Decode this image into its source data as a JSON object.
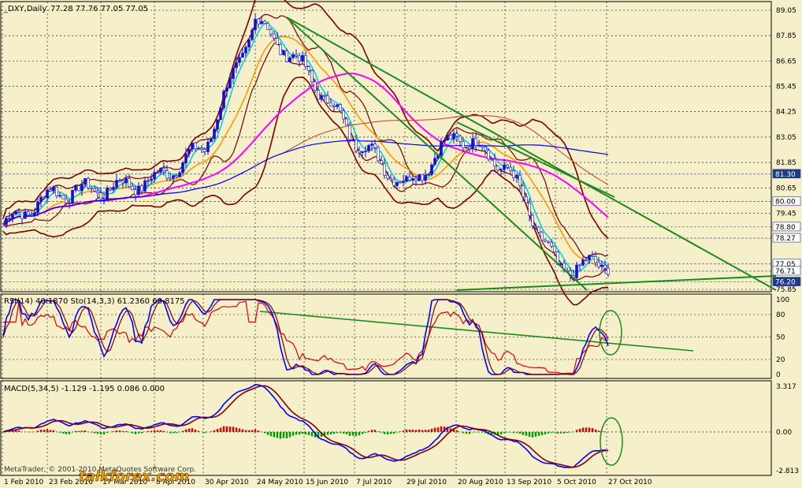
{
  "header": {
    "symbol": "_DXY,Daily",
    "ohlc": "77.28 77.76 77.05 77.05"
  },
  "colors": {
    "background": "#f5f0c9",
    "grid": "#000000",
    "bull_candle": "#1010d0",
    "bear_candle": "#ffffff",
    "bollinger": "#7b0000",
    "ma_orange": "#ff9900",
    "ma_cyan": "#00d0e0",
    "ma_magenta": "#ff00ff",
    "ma_brown": "#c04020",
    "ma_blue": "#0000ff",
    "trendline": "#1e8a1e",
    "rsi": "#e00000",
    "stoch_main": "#0000ff",
    "stoch_signal": "#800000",
    "macd_up": "#e00000",
    "macd_down": "#009900"
  },
  "price_axis": {
    "ticks": [
      "89.05",
      "87.85",
      "86.65",
      "85.45",
      "84.25",
      "83.05",
      "81.85",
      "80.65",
      "79.45",
      "75.85"
    ],
    "boxed_levels": [
      {
        "label": "81.30",
        "bg": "#1e3a8a"
      },
      {
        "label": "80.00",
        "bg": "#ffffff"
      },
      {
        "label": "78.80",
        "bg": "#ffffff"
      },
      {
        "label": "78.27",
        "bg": "#ffffff"
      },
      {
        "label": "77.05",
        "bg": "#ffffff"
      },
      {
        "label": "76.71",
        "bg": "#ffffff"
      },
      {
        "label": "76.20",
        "bg": "#1e3a8a"
      }
    ]
  },
  "rsi_panel": {
    "label": "RSI(14) 40.1870  Sto(14,3,3) 61.2360 68.8175",
    "ticks": [
      "100",
      "80",
      "50",
      "20",
      "0"
    ]
  },
  "macd_panel": {
    "label": "MACD(5,34,5) -1.129 -1.195 0.086 0.000",
    "ticks": [
      "3.317",
      "0.00",
      "-2.813"
    ]
  },
  "date_axis": [
    "1 Feb 2010",
    "23 Feb 2010",
    "17 Mar 2010",
    "8 Apr 2010",
    "30 Apr 2010",
    "24 May 2010",
    "15 Jun 2010",
    "7 Jul 2010",
    "29 Jul 2010",
    "20 Aug 2010",
    "13 Sep 2010",
    "5 Oct 2010",
    "27 Oct 2010"
  ],
  "footer": {
    "copyright": "MetaTrader, © 2001-2010 MetaQuotes Software Corp.",
    "watermark": "talkforex.com"
  },
  "chart_data": {
    "type": "line",
    "x": [
      "1 Feb 2010",
      "23 Feb 2010",
      "17 Mar 2010",
      "8 Apr 2010",
      "30 Apr 2010",
      "24 May 2010",
      "15 Jun 2010",
      "7 Jul 2010",
      "29 Jul 2010",
      "20 Aug 2010",
      "13 Sep 2010",
      "5 Oct 2010",
      "27 Oct 2010"
    ],
    "series": [
      {
        "values": [
          78.9,
          80.4,
          80.6,
          81.0,
          82.6,
          88.6,
          86.2,
          82.9,
          80.7,
          83.2,
          81.6,
          76.8,
          77.1
        ]
      }
    ],
    "ylim": [
      75.85,
      89.05
    ]
  }
}
